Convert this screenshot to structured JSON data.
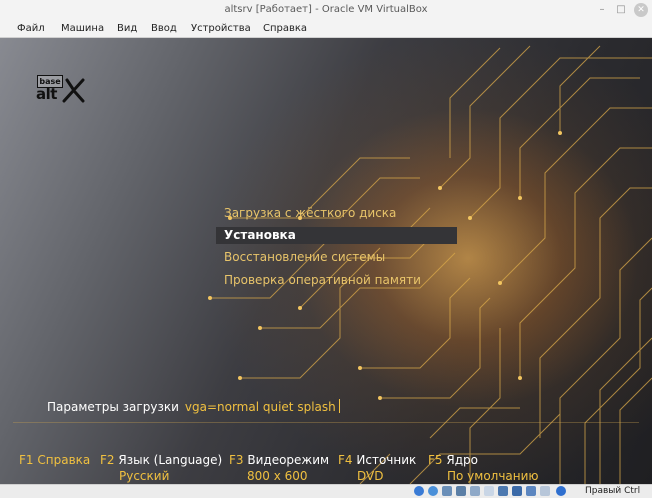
{
  "window": {
    "title": "altsrv [Работает] - Oracle VM VirtualBox",
    "minimize": "–",
    "maximize": "□",
    "close": "✕"
  },
  "menubar": [
    "Файл",
    "Машина",
    "Вид",
    "Ввод",
    "Устройства",
    "Справка"
  ],
  "logo": {
    "top": "base",
    "bottom": "alt"
  },
  "boot_menu": [
    {
      "label": "Загрузка с жёсткого диска",
      "selected": false
    },
    {
      "label": "Установка",
      "selected": true
    },
    {
      "label": "Восстановление системы",
      "selected": false
    },
    {
      "label": "Проверка оперативной памяти",
      "selected": false
    }
  ],
  "boot_params": {
    "label": "Параметры загрузки",
    "value": "vga=normal quiet splash"
  },
  "function_keys": [
    {
      "key": "F1",
      "label": "Справка",
      "value": ""
    },
    {
      "key": "F2",
      "label": "Язык (Language)",
      "value": "Русский"
    },
    {
      "key": "F3",
      "label": "Видеорежим",
      "value": "800 x 600"
    },
    {
      "key": "F4",
      "label": "Источник",
      "value": "DVD"
    },
    {
      "key": "F5",
      "label": "Ядро",
      "value": "По умолчанию"
    }
  ],
  "statusbar": {
    "icons": [
      "hard-disk-icon",
      "optical-drive-icon",
      "audio-icon",
      "network-icon",
      "usb-icon",
      "shared-folders-icon",
      "display-icon",
      "video-capture-icon",
      "recording-icon",
      "cpu-icon",
      "mouse-integration-icon"
    ],
    "host_key": "Правый Ctrl"
  },
  "colors": {
    "accent": "#f0c040",
    "selection_bg": "#343437",
    "menu_text": "#e8c46a"
  }
}
